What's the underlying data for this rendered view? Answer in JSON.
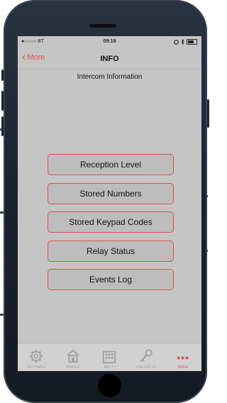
{
  "status_bar": {
    "carrier": "●○○○○ BT",
    "time": "09:19"
  },
  "nav": {
    "back_label": "More",
    "title": "INFO"
  },
  "subtitle": "Intercom Information",
  "menu": [
    "Reception Level",
    "Stored Numbers",
    "Stored Keypad Codes",
    "Relay Status",
    "Events Log"
  ],
  "tabs": [
    {
      "label": "SETTINGS",
      "icon": "gear-icon"
    },
    {
      "label": "SINGLE",
      "icon": "house-icon"
    },
    {
      "label": "MULTI",
      "icon": "building-icon"
    },
    {
      "label": "CALLER ID",
      "icon": "key-icon"
    },
    {
      "label": "More",
      "icon": "more-dots-icon",
      "active": true
    }
  ],
  "colors": {
    "accent": "#d9534f",
    "screen_bg": "#c5c5c5",
    "phone_body": "#1d232e"
  }
}
